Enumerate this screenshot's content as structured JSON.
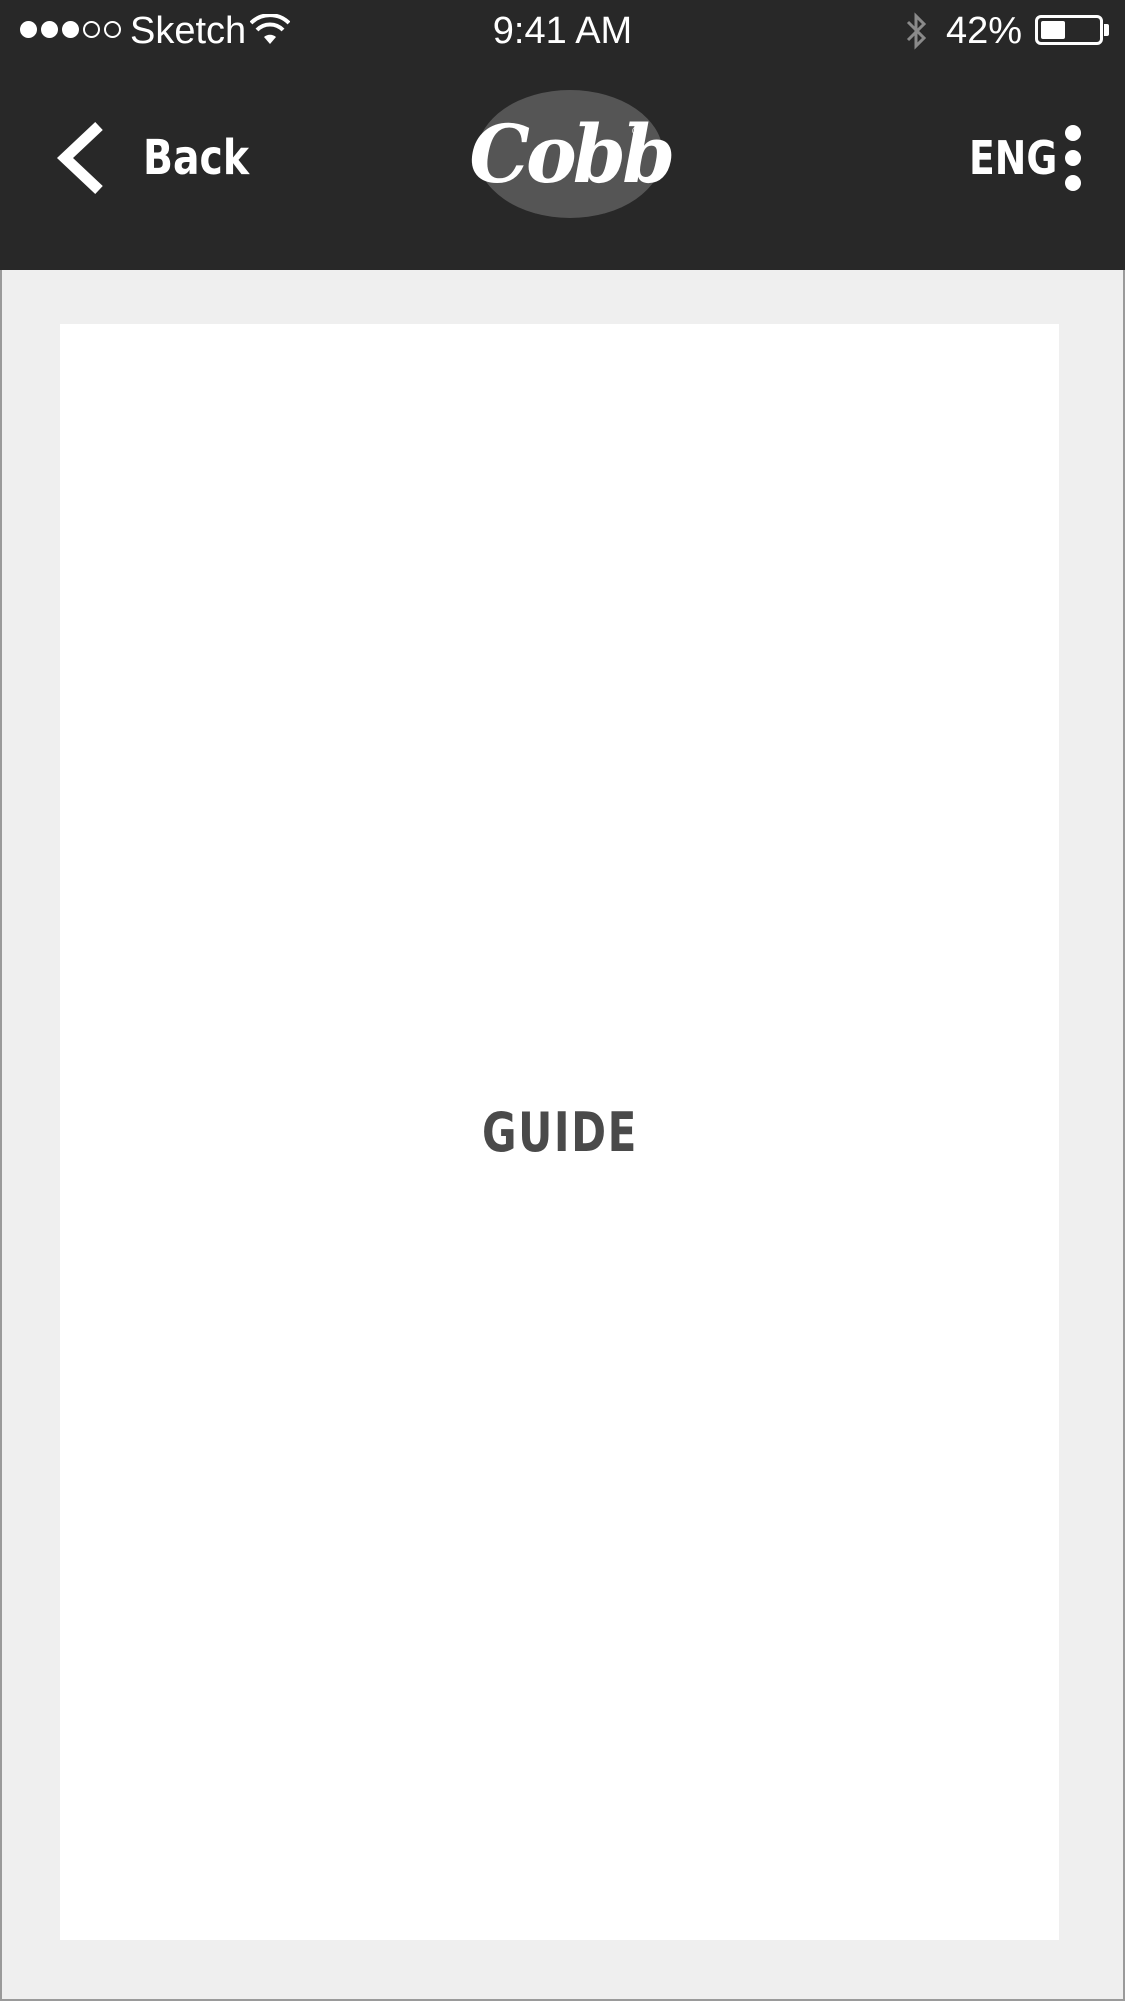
{
  "status_bar": {
    "signal_dots": [
      true,
      true,
      true,
      false,
      false
    ],
    "carrier": "Sketch",
    "time": "9:41 AM",
    "battery_percent_label": "42%",
    "battery_level": 0.42,
    "icons": [
      "wifi-icon",
      "bluetooth-icon",
      "battery-icon"
    ]
  },
  "nav": {
    "back_label": "Back",
    "back_icon": "chevron-left-icon",
    "logo_text": "Cobb",
    "logo_mark": "®",
    "language": "ENG",
    "more_icon": "more-vertical-icon"
  },
  "content": {
    "card_label": "GUIDE"
  },
  "colors": {
    "header_bg": "#282828",
    "page_bg": "#efefef",
    "card_bg": "#ffffff",
    "logo_bg": "#555555",
    "card_text": "#4a4a4a"
  }
}
